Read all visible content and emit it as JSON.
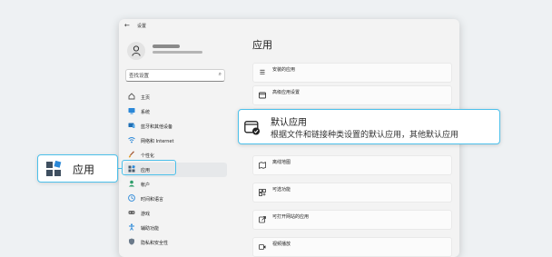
{
  "window": {
    "title": "设置"
  },
  "sidebar": {
    "search_placeholder": "查找设置",
    "items": [
      {
        "label": "主页",
        "icon": "home-icon"
      },
      {
        "label": "系统",
        "icon": "system-icon"
      },
      {
        "label": "蓝牙和其他设备",
        "icon": "bluetooth-icon"
      },
      {
        "label": "网络和 Internet",
        "icon": "network-icon"
      },
      {
        "label": "个性化",
        "icon": "personalization-icon"
      },
      {
        "label": "应用",
        "icon": "apps-icon"
      },
      {
        "label": "帐户",
        "icon": "account-icon"
      },
      {
        "label": "时间和语言",
        "icon": "time-language-icon"
      },
      {
        "label": "游戏",
        "icon": "gaming-icon"
      },
      {
        "label": "辅助功能",
        "icon": "accessibility-icon"
      },
      {
        "label": "隐私和安全性",
        "icon": "privacy-icon"
      }
    ]
  },
  "content": {
    "title": "应用",
    "cards": [
      {
        "title": "安装的应用",
        "subtitle": ""
      },
      {
        "title": "高级应用设置",
        "subtitle": ""
      },
      {
        "title": "",
        "subtitle": ""
      },
      {
        "title": "离线地图",
        "subtitle": ""
      },
      {
        "title": "可选功能",
        "subtitle": ""
      },
      {
        "title": "可打开网站的应用",
        "subtitle": ""
      },
      {
        "title": "视频播放",
        "subtitle": ""
      }
    ]
  },
  "callouts": {
    "left_label": "应用",
    "right_title": "默认应用",
    "right_subtitle": "根据文件和链接种类设置的默认应用，其他默认应用"
  },
  "colors": {
    "accent": "#4cc0ea",
    "highlight_bg": "#e6e8ea"
  }
}
